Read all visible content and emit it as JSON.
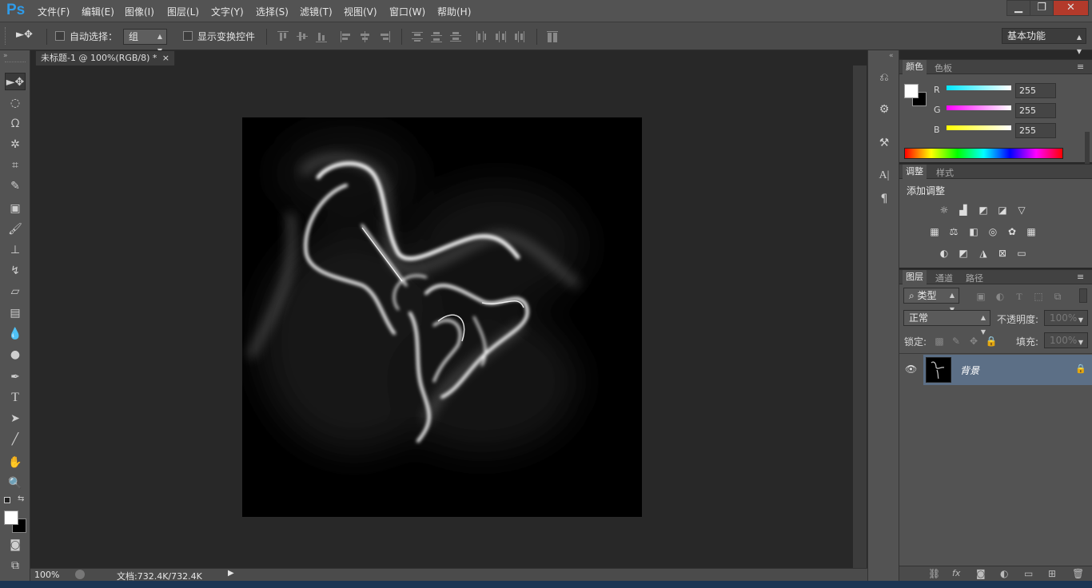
{
  "app": {
    "logo": "Ps"
  },
  "menu": [
    "文件(F)",
    "编辑(E)",
    "图像(I)",
    "图层(L)",
    "文字(Y)",
    "选择(S)",
    "滤镜(T)",
    "视图(V)",
    "窗口(W)",
    "帮助(H)"
  ],
  "window_controls": {
    "minimize": "▁",
    "restore": "❐",
    "close": "✕"
  },
  "options": {
    "auto_select_label": "自动选择：",
    "auto_select_value": "组",
    "show_transform_label": "显示变换控件",
    "workspace": "基本功能"
  },
  "document": {
    "tab_title": "未标题-1 @ 100%(RGB/8) *",
    "close": "×"
  },
  "status": {
    "zoom": "100%",
    "doc_info": "文档:732.4K/732.4K"
  },
  "color_panel": {
    "tabs": [
      "颜色",
      "色板"
    ],
    "channels": [
      {
        "label": "R",
        "value": "255",
        "color": "#00e8ff"
      },
      {
        "label": "G",
        "value": "255",
        "color": "#ff00ff"
      },
      {
        "label": "B",
        "value": "255",
        "color": "#ffff00"
      }
    ]
  },
  "adjust_panel": {
    "tabs": [
      "调整",
      "样式"
    ],
    "title": "添加调整"
  },
  "layers_panel": {
    "tabs": [
      "图层",
      "通道",
      "路径"
    ],
    "filter_type": "类型",
    "blend_mode": "正常",
    "opacity_label": "不透明度:",
    "opacity_value": "100%",
    "lock_label": "锁定:",
    "fill_label": "填充:",
    "fill_value": "100%",
    "layers": [
      {
        "name": "背景",
        "visible": true,
        "locked": true
      }
    ]
  },
  "colors": {
    "accent": "#2f9be8",
    "selected_layer": "#5c6f86"
  }
}
